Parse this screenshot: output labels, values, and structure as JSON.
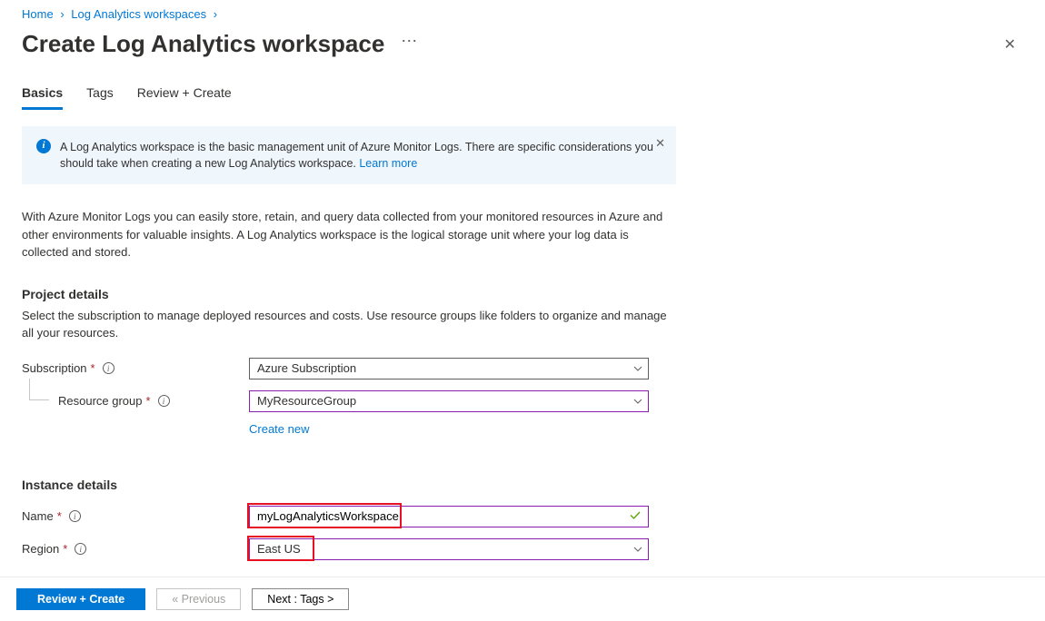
{
  "breadcrumb": {
    "home": "Home",
    "workspaces": "Log Analytics workspaces"
  },
  "header": {
    "title": "Create Log Analytics workspace"
  },
  "tabs": {
    "basics": "Basics",
    "tags": "Tags",
    "review": "Review + Create"
  },
  "info_box": {
    "text": "A Log Analytics workspace is the basic management unit of Azure Monitor Logs. There are specific considerations you should take when creating a new Log Analytics workspace. ",
    "learn_more": "Learn more"
  },
  "intro": "With Azure Monitor Logs you can easily store, retain, and query data collected from your monitored resources in Azure and other environments for valuable insights. A Log Analytics workspace is the logical storage unit where your log data is collected and stored.",
  "project": {
    "title": "Project details",
    "desc": "Select the subscription to manage deployed resources and costs. Use resource groups like folders to organize and manage all your resources.",
    "subscription_label": "Subscription",
    "subscription_value": "Azure Subscription",
    "resource_group_label": "Resource group",
    "resource_group_value": "MyResourceGroup",
    "create_new": "Create new"
  },
  "instance": {
    "title": "Instance details",
    "name_label": "Name",
    "name_value": "myLogAnalyticsWorkspace",
    "region_label": "Region",
    "region_value": "East US"
  },
  "footer": {
    "review": "Review + Create",
    "previous": "« Previous",
    "next": "Next : Tags >"
  }
}
